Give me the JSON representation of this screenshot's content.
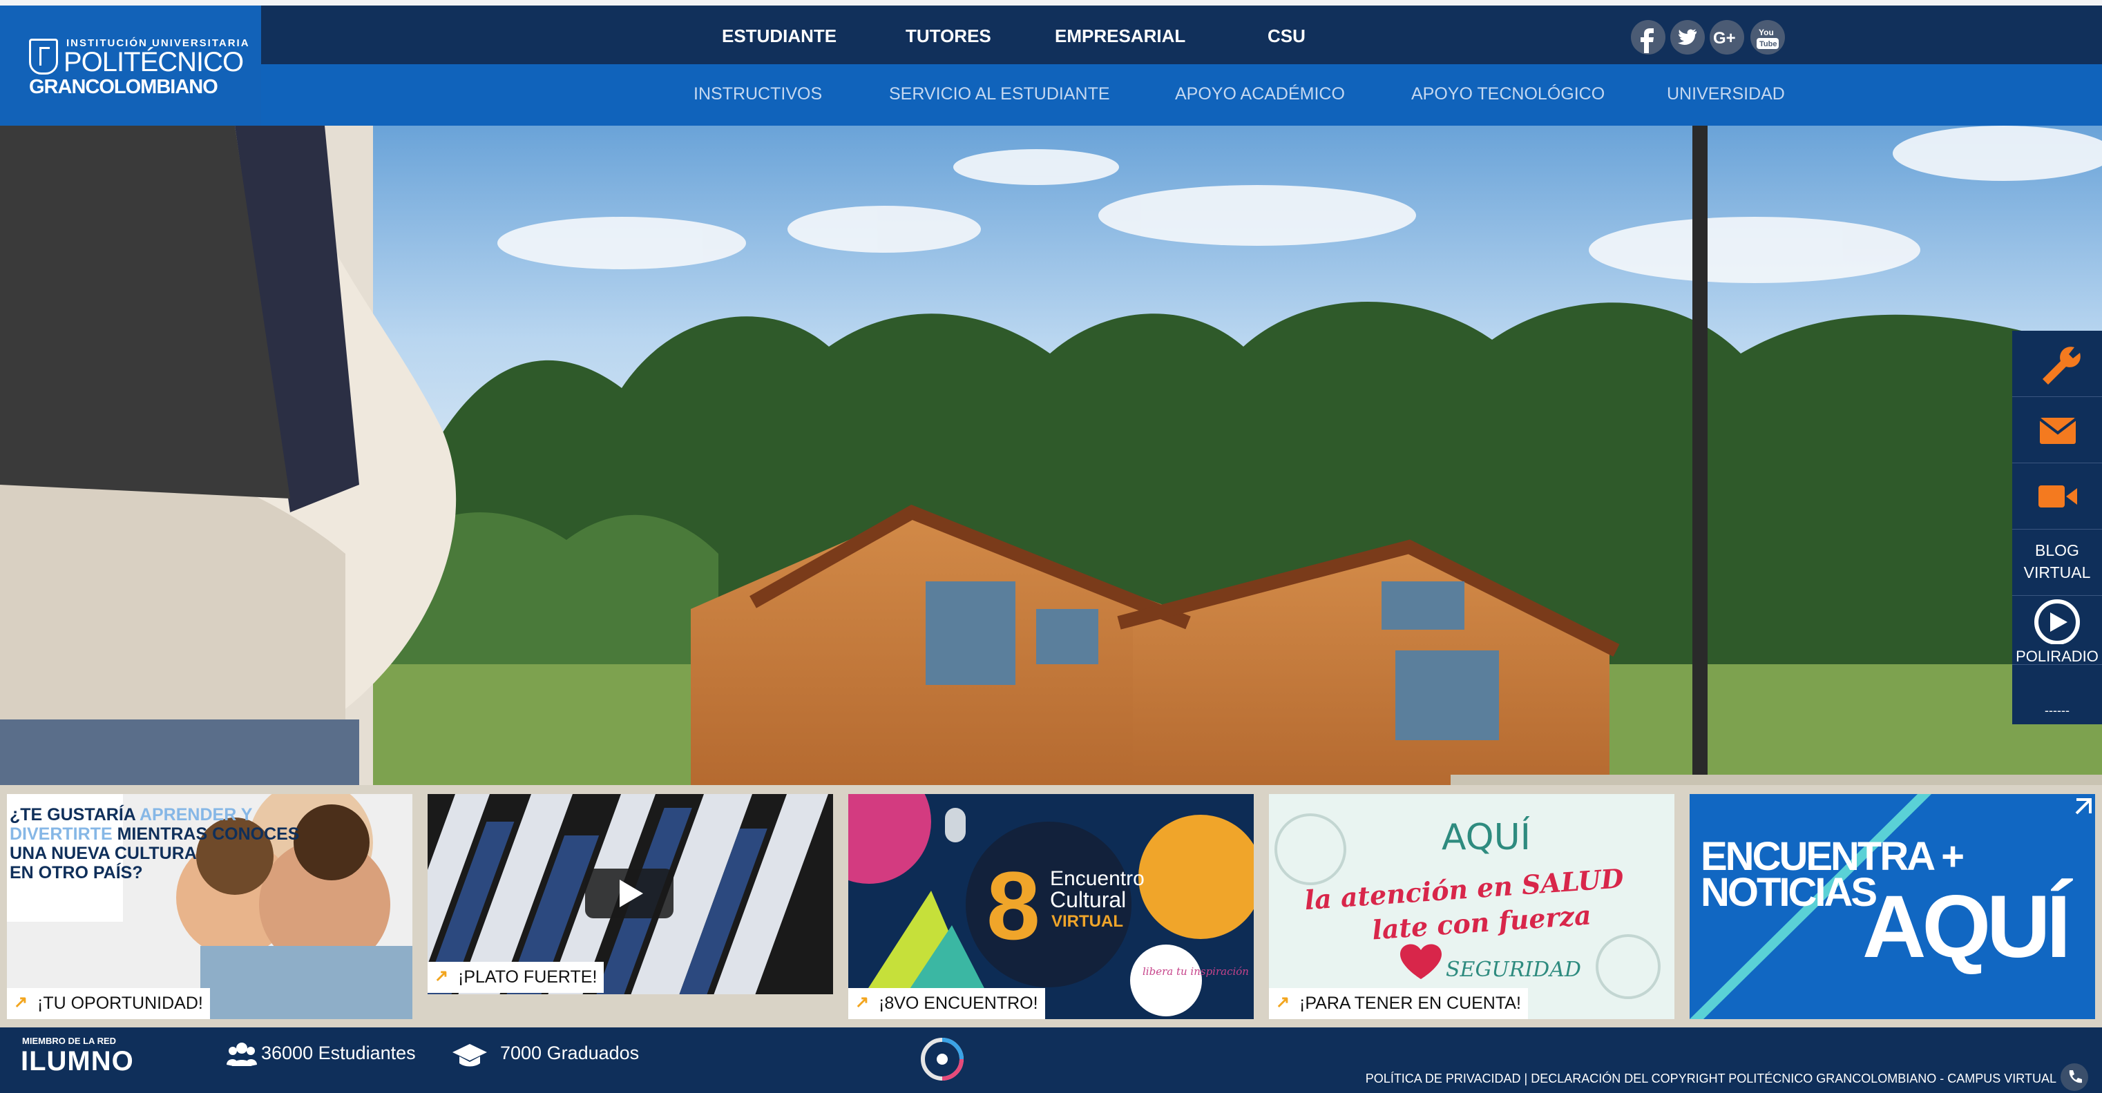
{
  "brand": {
    "institution_line": "INSTITUCIÓN UNIVERSITARIA",
    "name_line1": "POLITÉCNICO",
    "name_line2": "GRANCOLOMBIANO"
  },
  "main_nav": [
    "ESTUDIANTE",
    "TUTORES",
    "EMPRESARIAL",
    "CSU"
  ],
  "sub_nav": [
    "INSTRUCTIVOS",
    "SERVICIO AL ESTUDIANTE",
    "APOYO ACADÉMICO",
    "APOYO TECNOLÓGICO",
    "UNIVERSIDAD"
  ],
  "social": [
    "facebook-icon",
    "twitter-icon",
    "google-plus-icon",
    "youtube-icon"
  ],
  "social_youtube_text": "You Tube",
  "side_tools": {
    "blog": "BLOG VIRTUAL",
    "radio": "POLIRADIO",
    "more": "------"
  },
  "cards": [
    {
      "label": "¡TU OPORTUNIDAD!",
      "headline": "¿TE GUSTARÍA APRENDER Y DIVERTIRTE MIENTRAS CONOCES UNA NUEVA CULTURA EN OTRO PAÍS?"
    },
    {
      "label": "¡PLATO FUERTE!"
    },
    {
      "label": "¡8VO ENCUENTRO!",
      "number": "8",
      "title_line1": "Encuentro",
      "title_line2": "Cultural",
      "title_line3": "VIRTUAL",
      "badge": "libera tu inspiración"
    },
    {
      "label": "¡PARA TENER EN CUENTA!",
      "line1": "AQUÍ",
      "line2": "la atención en SALUD",
      "line3": "late con fuerza",
      "line4": "SEGURIDAD"
    },
    {
      "line1": "ENCUENTRA +",
      "line2": "NOTICIAS",
      "line3": "AQUÍ"
    }
  ],
  "footer": {
    "network": "MIEMBRO DE LA RED",
    "ilumno": "ILUMNO",
    "students": "36000 Estudiantes",
    "graduates": "7000 Graduados",
    "legal": "POLÍTICA DE PRIVACIDAD | DECLARACIÓN DEL COPYRIGHT POLITÉCNICO GRANCOLOMBIANO - CAMPUS VIRTUAL"
  },
  "colors": {
    "header_dark": "#11305b",
    "header_blue": "#1063bb",
    "accent_orange": "#f47a1f",
    "card_label_arrow": "#f2a51e"
  }
}
